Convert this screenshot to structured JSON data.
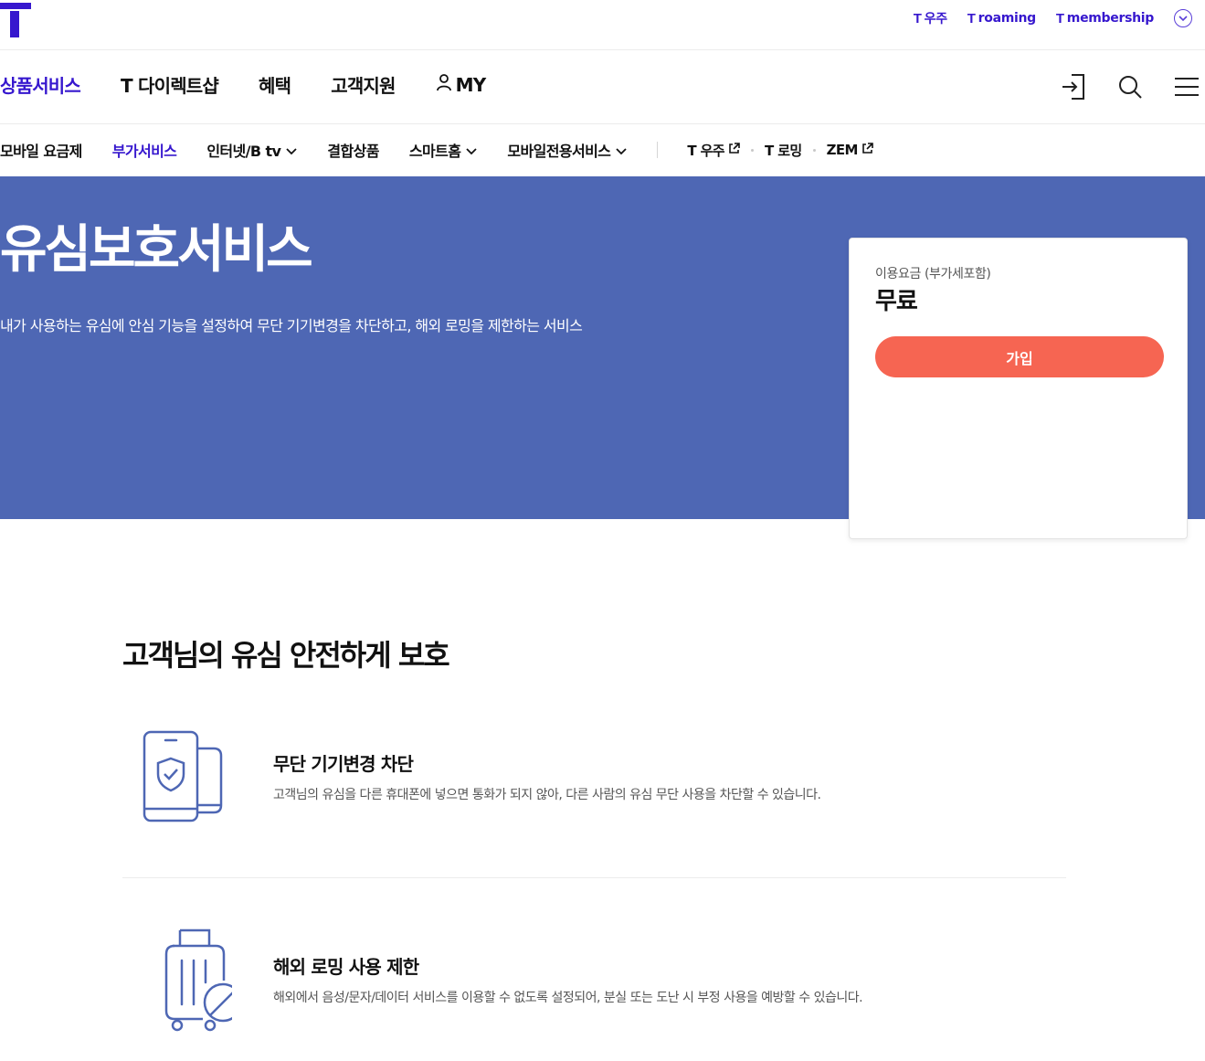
{
  "util_links": [
    {
      "prefix": "T",
      "label": "우주"
    },
    {
      "prefix": "T",
      "label": "roaming"
    },
    {
      "prefix": "T",
      "label": "membership"
    }
  ],
  "gnb": {
    "items": [
      "상품서비스",
      "T 다이렉트샵",
      "혜택",
      "고객지원",
      "MY"
    ]
  },
  "lnb": {
    "items": [
      "모바일 요금제",
      "부가서비스",
      "인터넷/B tv",
      "결합상품",
      "스마트홈",
      "모바일전용서비스"
    ],
    "external": [
      "T 우주",
      "T 로밍",
      "ZEM"
    ]
  },
  "hero": {
    "title": "유심보호서비스",
    "description": "내가 사용하는 유심에 안심 기능을 설정하여 무단 기기변경을 차단하고, 해외 로밍을 제한하는 서비스"
  },
  "price_card": {
    "label": "이용요금 (부가세포함)",
    "value": "무료",
    "join_label": "가입"
  },
  "section": {
    "title": "고객님의 유심 안전하게 보호"
  },
  "features": [
    {
      "title": "무단 기기변경 차단",
      "description": "고객님의 유심을 다른 휴대폰에 넣으면 통화가 되지 않아, 다른 사람의 유심 무단 사용을 차단할 수 있습니다."
    },
    {
      "title": "해외 로밍 사용 제한",
      "description": "해외에서 음성/문자/데이터 서비스를 이용할 수 없도록 설정되어, 분실 또는 도난 시 부정 사용을 예방할 수 있습니다."
    }
  ],
  "colors": {
    "brand": "#3617ce",
    "hero_bg": "#4e67b4",
    "join_button": "#f66552",
    "icon_stroke": "#4e67b4"
  },
  "icons": [
    "t-logo-icon",
    "chevron-down-circle-icon",
    "user-icon",
    "login-icon",
    "search-icon",
    "menu-icon",
    "chevron-down-icon",
    "external-link-icon",
    "phone-shield-icon",
    "luggage-blocked-icon"
  ]
}
